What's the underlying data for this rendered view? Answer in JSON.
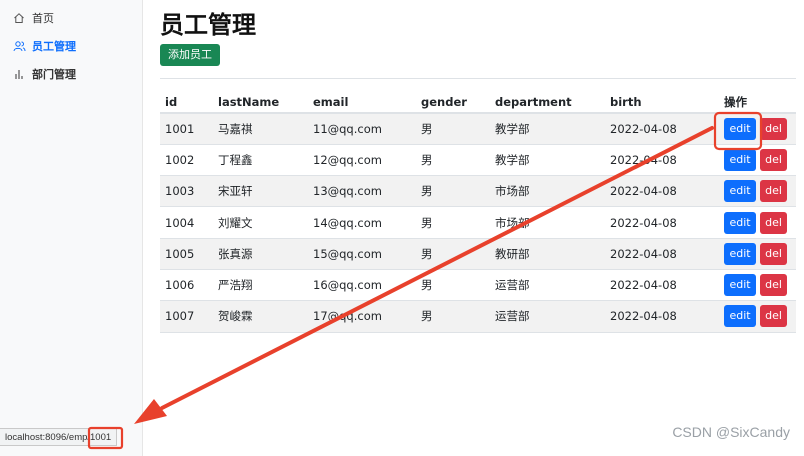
{
  "sidebar": {
    "items": [
      {
        "label": "首页",
        "icon": "home-icon"
      },
      {
        "label": "员工管理",
        "icon": "users-icon"
      },
      {
        "label": "部门管理",
        "icon": "bar-chart-icon"
      }
    ],
    "active_index": 1
  },
  "main": {
    "title": "员工管理",
    "add_button": "添加员工"
  },
  "table": {
    "headers": [
      "id",
      "lastName",
      "email",
      "gender",
      "department",
      "birth",
      "操作"
    ],
    "rows": [
      {
        "id": "1001",
        "lastName": "马嘉祺",
        "email": "11@qq.com",
        "gender": "男",
        "department": "教学部",
        "birth": "2022-04-08"
      },
      {
        "id": "1002",
        "lastName": "丁程鑫",
        "email": "12@qq.com",
        "gender": "男",
        "department": "教学部",
        "birth": "2022-04-08"
      },
      {
        "id": "1003",
        "lastName": "宋亚轩",
        "email": "13@qq.com",
        "gender": "男",
        "department": "市场部",
        "birth": "2022-04-08"
      },
      {
        "id": "1004",
        "lastName": "刘耀文",
        "email": "14@qq.com",
        "gender": "男",
        "department": "市场部",
        "birth": "2022-04-08"
      },
      {
        "id": "1005",
        "lastName": "张真源",
        "email": "15@qq.com",
        "gender": "男",
        "department": "教研部",
        "birth": "2022-04-08"
      },
      {
        "id": "1006",
        "lastName": "严浩翔",
        "email": "16@qq.com",
        "gender": "男",
        "department": "运营部",
        "birth": "2022-04-08"
      },
      {
        "id": "1007",
        "lastName": "贺峻霖",
        "email": "17@qq.com",
        "gender": "男",
        "department": "运营部",
        "birth": "2022-04-08"
      }
    ],
    "edit_label": "edit",
    "del_label": "del"
  },
  "statusbar": {
    "url": "localhost:8096/emp/1001"
  },
  "watermark": "CSDN @SixCandy",
  "colors": {
    "primary": "#0d6efd",
    "success": "#198754",
    "danger": "#dc3545",
    "annotation": "#e8412c"
  }
}
